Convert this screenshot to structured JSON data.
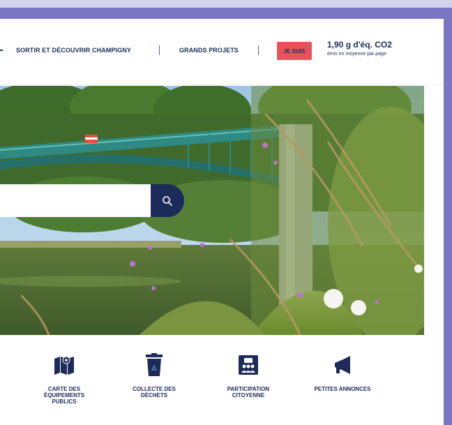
{
  "header": {
    "nav": [
      {
        "label": "SORTIR ET DÉCOUVRIR CHAMPIGNY"
      },
      {
        "label": "GRANDS PROJETS"
      }
    ],
    "je_suis_label": "JE SUIS",
    "co2": {
      "value": "1,90 g d'éq. CO2",
      "caption": "émis en moyenne par page"
    }
  },
  "search": {
    "placeholder": ""
  },
  "quick_links": [
    {
      "label": "CARTE DES ÉQUIPEMENTS PUBLICS",
      "icon": "map-icon"
    },
    {
      "label": "COLLECTE DES DÉCHETS",
      "icon": "recycling-bin-icon"
    },
    {
      "label": "PARTICIPATION CITOYENNE",
      "icon": "citizen-participation-icon"
    },
    {
      "label": "PETITES ANNONCES",
      "icon": "megaphone-icon"
    }
  ],
  "colors": {
    "brand_navy": "#1c2b5a",
    "accent_red": "#e8535b",
    "frame_purple": "#7b76c4",
    "bridge_teal": "#2f8a84"
  }
}
